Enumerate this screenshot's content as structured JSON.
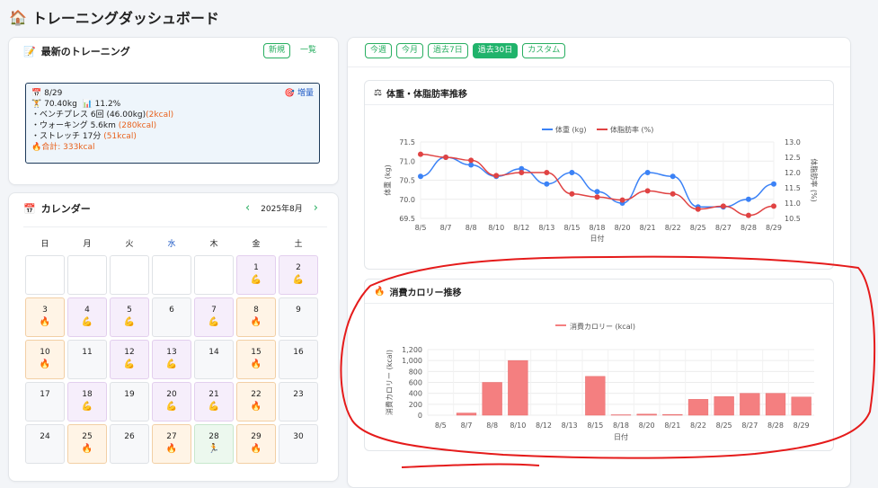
{
  "header": {
    "title": "トレーニングダッシュボード"
  },
  "latest": {
    "title": "最新のトレーニング",
    "new_label": "新規",
    "list_label": "一覧",
    "date": "8/29",
    "badge": "増量",
    "weight": "70.40kg",
    "fat": "11.2%",
    "items": [
      {
        "text": "・ベンチプレス 6回 (46.00kg)",
        "kcal": "(2kcal)"
      },
      {
        "text": "・ウォーキング 5.6km ",
        "kcal": "(280kcal)"
      },
      {
        "text": "・ストレッチ 17分 ",
        "kcal": "(51kcal)"
      }
    ],
    "total": "合計: 333kcal"
  },
  "calendar": {
    "title": "カレンダー",
    "month": "2025年8月",
    "prev": "‹",
    "next": "›",
    "weekdays": [
      "日",
      "月",
      "火",
      "水",
      "木",
      "金",
      "土"
    ],
    "weekday_colors": [
      "#222",
      "#222",
      "#222",
      "#1a56c4",
      "#222",
      "#222",
      "#222"
    ],
    "days": [
      {
        "d": "",
        "t": "empty",
        "i": ""
      },
      {
        "d": "",
        "t": "empty",
        "i": ""
      },
      {
        "d": "",
        "t": "empty",
        "i": ""
      },
      {
        "d": "",
        "t": "empty",
        "i": ""
      },
      {
        "d": "",
        "t": "empty",
        "i": ""
      },
      {
        "d": "1",
        "t": "purple",
        "i": "💪"
      },
      {
        "d": "2",
        "t": "purple",
        "i": "💪"
      },
      {
        "d": "3",
        "t": "orangeb",
        "i": "🔥"
      },
      {
        "d": "4",
        "t": "purple",
        "i": "💪"
      },
      {
        "d": "5",
        "t": "purple",
        "i": "💪"
      },
      {
        "d": "6",
        "t": "plain",
        "i": ""
      },
      {
        "d": "7",
        "t": "purple",
        "i": "💪"
      },
      {
        "d": "8",
        "t": "orangeb",
        "i": "🔥"
      },
      {
        "d": "9",
        "t": "plain",
        "i": ""
      },
      {
        "d": "10",
        "t": "orangeb",
        "i": "🔥"
      },
      {
        "d": "11",
        "t": "plain",
        "i": ""
      },
      {
        "d": "12",
        "t": "purple",
        "i": "💪"
      },
      {
        "d": "13",
        "t": "purple",
        "i": "💪"
      },
      {
        "d": "14",
        "t": "plain",
        "i": ""
      },
      {
        "d": "15",
        "t": "orangeb",
        "i": "🔥"
      },
      {
        "d": "16",
        "t": "plain",
        "i": ""
      },
      {
        "d": "17",
        "t": "plain",
        "i": ""
      },
      {
        "d": "18",
        "t": "purple",
        "i": "💪"
      },
      {
        "d": "19",
        "t": "plain",
        "i": ""
      },
      {
        "d": "20",
        "t": "purple",
        "i": "💪"
      },
      {
        "d": "21",
        "t": "purple",
        "i": "💪"
      },
      {
        "d": "22",
        "t": "orangeb",
        "i": "🔥"
      },
      {
        "d": "23",
        "t": "plain",
        "i": ""
      },
      {
        "d": "24",
        "t": "plain",
        "i": ""
      },
      {
        "d": "25",
        "t": "orangeb",
        "i": "🔥"
      },
      {
        "d": "26",
        "t": "plain",
        "i": ""
      },
      {
        "d": "27",
        "t": "orangeb",
        "i": "🔥"
      },
      {
        "d": "28",
        "t": "green",
        "i": "🏃"
      },
      {
        "d": "29",
        "t": "orangeb",
        "i": "🔥"
      },
      {
        "d": "30",
        "t": "plain",
        "i": ""
      }
    ]
  },
  "filters": {
    "items": [
      "今週",
      "今月",
      "過去7日",
      "過去30日",
      "カスタム"
    ],
    "active": "過去30日"
  },
  "weight_chart": {
    "title": "体重・体脂肪率推移"
  },
  "calorie_chart": {
    "title": "消費カロリー推移"
  },
  "colors": {
    "weight": "#3b82f6",
    "fat": "#e04343",
    "calorie": "#f47f80",
    "accent": "#20b36b"
  },
  "chart_data": [
    {
      "type": "line",
      "title": "",
      "categories": [
        "8/5",
        "8/7",
        "8/8",
        "8/10",
        "8/12",
        "8/13",
        "8/15",
        "8/18",
        "8/20",
        "8/21",
        "8/22",
        "8/25",
        "8/27",
        "8/28",
        "8/29"
      ],
      "series": [
        {
          "name": "体重 (kg)",
          "axis": "left",
          "values": [
            70.6,
            71.1,
            70.9,
            70.6,
            70.8,
            70.4,
            70.7,
            70.2,
            69.9,
            70.7,
            70.6,
            69.8,
            69.8,
            70.0,
            70.4
          ]
        },
        {
          "name": "体脂肪率 (%)",
          "axis": "right",
          "values": [
            12.6,
            12.5,
            12.4,
            11.9,
            12.0,
            12.0,
            11.3,
            11.2,
            11.1,
            11.4,
            11.3,
            10.8,
            10.9,
            10.6,
            10.9
          ]
        }
      ],
      "xlabel": "日付",
      "ylabel": "体重 (kg)",
      "y2label": "体脂肪率 (%)",
      "ylim": [
        69.5,
        71.5
      ],
      "y2lim": [
        10.5,
        13.0
      ],
      "yticks": [
        "69.5",
        "70.0",
        "70.5",
        "71.0",
        "71.5"
      ],
      "y2ticks": [
        "10.5",
        "11.0",
        "11.5",
        "12.0",
        "12.5",
        "13.0"
      ],
      "grid": true,
      "legend": "top"
    },
    {
      "type": "bar",
      "title": "",
      "categories": [
        "8/5",
        "8/7",
        "8/8",
        "8/10",
        "8/12",
        "8/13",
        "8/15",
        "8/18",
        "8/20",
        "8/21",
        "8/22",
        "8/25",
        "8/27",
        "8/28",
        "8/29"
      ],
      "series": [
        {
          "name": "消費カロリー (kcal)",
          "values": [
            0,
            40,
            600,
            1000,
            0,
            0,
            710,
            8,
            20,
            14,
            290,
            340,
            400,
            400,
            333
          ]
        }
      ],
      "xlabel": "日付",
      "ylabel": "消費カロリー (kcal)",
      "ylim": [
        0,
        1200
      ],
      "yticks": [
        "0",
        "200",
        "400",
        "600",
        "800",
        "1,000",
        "1,200"
      ],
      "grid": true,
      "legend": "top"
    }
  ]
}
